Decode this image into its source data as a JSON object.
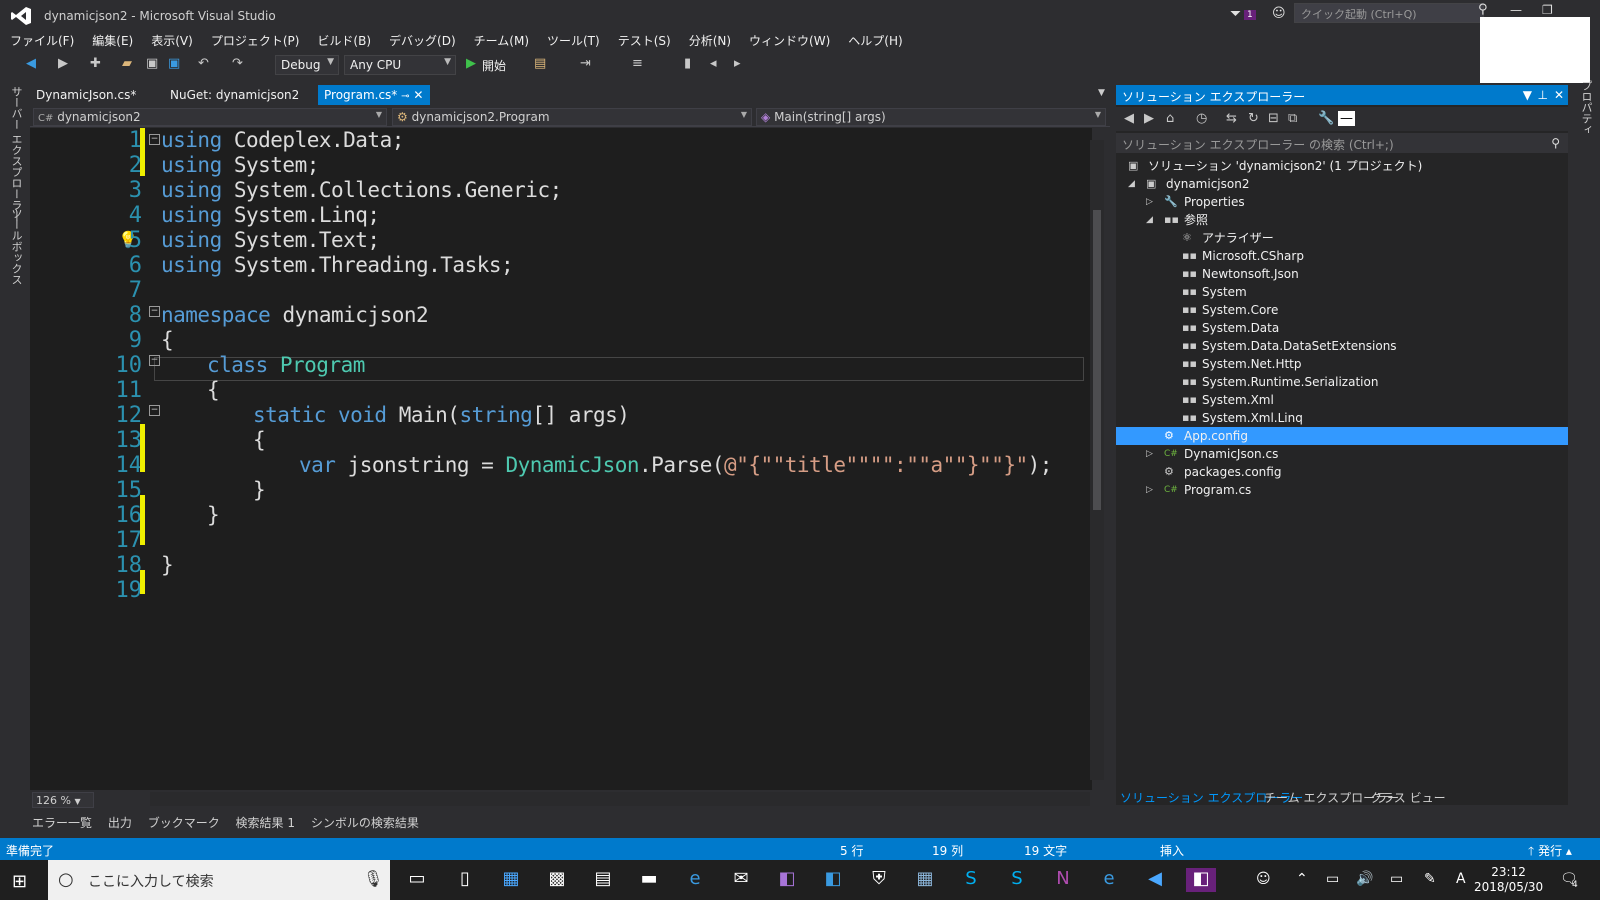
{
  "window": {
    "title": "dynamicjson2 - Microsoft Visual Studio",
    "quick_launch": "クイック起動 (Ctrl+Q)",
    "notification_count": "1"
  },
  "menu": [
    "ファイル(F)",
    "編集(E)",
    "表示(V)",
    "プロジェクト(P)",
    "ビルド(B)",
    "デバッグ(D)",
    "チーム(M)",
    "ツール(T)",
    "テスト(S)",
    "分析(N)",
    "ウィンドウ(W)",
    "ヘルプ(H)"
  ],
  "toolbar": {
    "config": "Debug",
    "platform": "Any CPU",
    "start": "開始"
  },
  "side": {
    "left_tabs": [
      "サーバー エクスプローラー",
      "ツールボックス"
    ],
    "right_tab": "プロパティ"
  },
  "doc_tabs": [
    "DynamicJson.cs*",
    "NuGet: dynamicjson2",
    "Program.cs*"
  ],
  "nav": {
    "project": "dynamicjson2",
    "type": "dynamicjson2.Program",
    "member": "Main(string[] args)"
  },
  "code_lines": [
    "1",
    "2",
    "3",
    "4",
    "5",
    "6",
    "7",
    "8",
    "9",
    "10",
    "11",
    "12",
    "13",
    "14",
    "15",
    "16",
    "17",
    "18",
    "19"
  ],
  "code": {
    "l1": "using",
    "l1b": " Codeplex.Data;",
    "l2": "using",
    "l2b": " System;",
    "l3": "using",
    "l3b": " System.Collections.Generic;",
    "l4": "using",
    "l4b": " System.Linq;",
    "l5": "using",
    "l5b": " System.Text;",
    "l6": "using",
    "l6b": " System.Threading.Tasks;",
    "l8": "namespace",
    "l8b": " dynamicjson2",
    "l9": "{",
    "l10": "class",
    "l10b": "Program",
    "l11": "{",
    "l12": "static void",
    "l12b": " Main(",
    "l12c": "string",
    "l12d": "[] args)",
    "l13": "{",
    "l14": "var",
    "l14b": " jsonstring = ",
    "l14c": "DynamicJson",
    "l14d": ".Parse(",
    "l14e": "@\"{\"\"title\"\"\"\":\"\"a\"\"}\"\"}\"",
    "l14f": ");",
    "l15": "}",
    "l16": "}",
    "l18": "}"
  },
  "zoom": "126 %",
  "bottom_tabs": [
    "エラー一覧",
    "出力",
    "ブックマーク",
    "検索結果 1",
    "シンボルの検索結果"
  ],
  "solution_explorer": {
    "title": "ソリューション エクスプローラー",
    "search": "ソリューション エクスプローラー の検索 (Ctrl+;)",
    "solution": "ソリューション 'dynamicjson2' (1 プロジェクト)",
    "project": "dynamicjson2",
    "properties": "Properties",
    "references": "参照",
    "refs": [
      "アナライザー",
      "Microsoft.CSharp",
      "Newtonsoft.Json",
      "System",
      "System.Core",
      "System.Data",
      "System.Data.DataSetExtensions",
      "System.Net.Http",
      "System.Runtime.Serialization",
      "System.Xml",
      "System.Xml.Linq"
    ],
    "files": [
      "App.config",
      "DynamicJson.cs",
      "packages.config",
      "Program.cs"
    ],
    "bottom_tabs": [
      "ソリューション エクスプローラー",
      "チーム エクスプローラー",
      "クラス ビュー"
    ]
  },
  "status": {
    "ready": "準備完了",
    "line": "5 行",
    "col": "19 列",
    "chars": "19 文字",
    "mode": "挿入",
    "publish": "発行"
  },
  "taskbar": {
    "search": "ここに入力して検索",
    "time": "23:12",
    "date": "2018/05/30",
    "ime": "A",
    "notif": "4"
  },
  "colors": {
    "accent": "#007acc",
    "keyword": "#569cd6",
    "type": "#4ec9b0",
    "string": "#d69d85",
    "line_number": "#2b91af",
    "change_mark": "#efef00"
  }
}
